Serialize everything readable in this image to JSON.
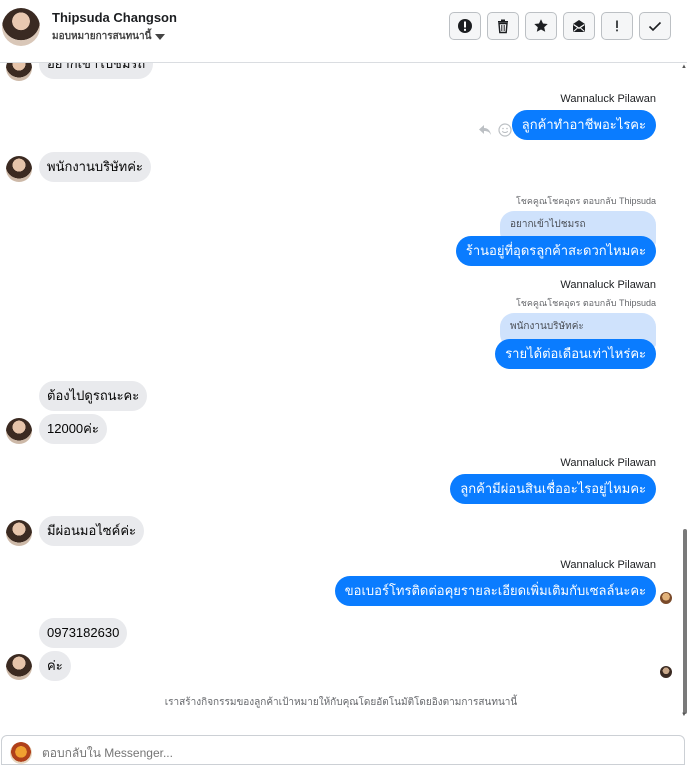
{
  "header": {
    "name": "Thipsuda Changson",
    "subtitle": "มอบหมายการสนทนานี้",
    "buttons": [
      {
        "icon": "alert-circle-icon",
        "label": "Mark as spam"
      },
      {
        "icon": "trash-icon",
        "label": "Delete"
      },
      {
        "icon": "star-icon",
        "label": "Star"
      },
      {
        "icon": "mark-unread-icon",
        "label": "Mark unread"
      },
      {
        "icon": "exclamation-icon",
        "label": "Follow up"
      },
      {
        "icon": "check-icon",
        "label": "Done"
      }
    ]
  },
  "messages": {
    "m1": "อยากเข้าไปชมรถ",
    "m2_sender": "Wannaluck Pilawan",
    "m2": "ลูกค้าทำอาชีพอะไรคะ",
    "m3": "พนักงานบริษัทค่ะ",
    "m4_replyto": "โชคคูณโชคอุดร ตอบกลับ Thipsuda",
    "m4_quote": "อยากเข้าไปชมรถ",
    "m4": "ร้านอยู่ที่อุดรลูกค้าสะดวกไหมคะ",
    "m5_sender": "Wannaluck Pilawan",
    "m5_replyto": "โชคคูณโชคอุดร ตอบกลับ Thipsuda",
    "m5_quote": "พนักงานบริษัทค่ะ",
    "m5": "รายได้ต่อเดือนเท่าไหร่คะ",
    "m6": "ต้องไปดูรถนะคะ",
    "m7": "12000ค่ะ",
    "m8_sender": "Wannaluck Pilawan",
    "m8": "ลูกค้ามีผ่อนสินเชื่ออะไรอยู่ไหมคะ",
    "m9": "มีผ่อนมอไซค์ค่ะ",
    "m10_sender": "Wannaluck Pilawan",
    "m10": "ขอเบอร์โทรติดต่อคุยรายละเอียดเพิ่มเติมกับเซลล์นะคะ",
    "m11": "0973182630",
    "m12": "ค่ะ"
  },
  "footer_note": "เราสร้างกิจกรรมของลูกค้าเป้าหมายให้กับคุณโดยอัตโนมัติโดยอิงตามการสนทนานี้",
  "composer": {
    "placeholder": "ตอบกลับใน Messenger..."
  },
  "colors": {
    "outgoing_bubble": "#0a7cff",
    "incoming_bubble": "#e9eaed",
    "quote_bubble": "#cfe2fc"
  }
}
